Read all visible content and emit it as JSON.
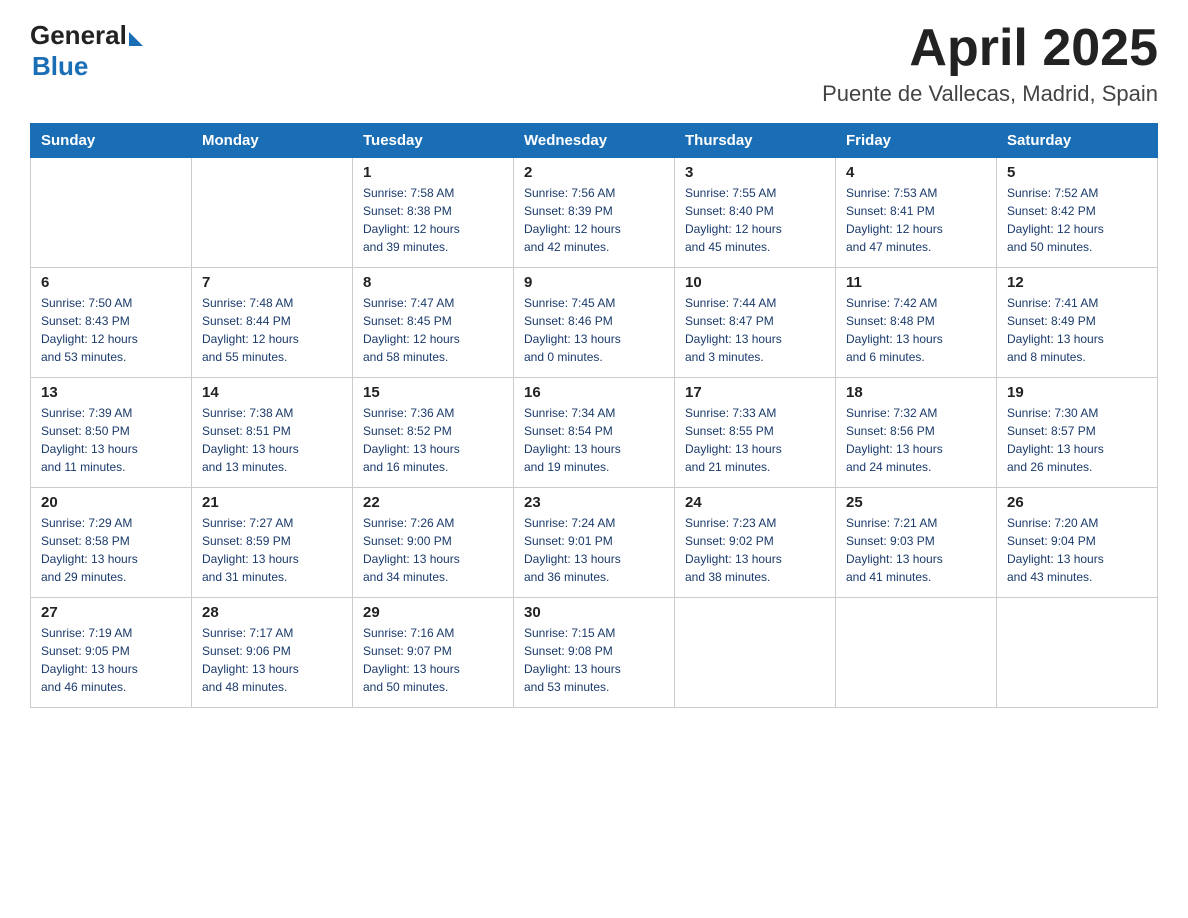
{
  "header": {
    "logo_general": "General",
    "logo_blue": "Blue",
    "month_title": "April 2025",
    "location": "Puente de Vallecas, Madrid, Spain"
  },
  "days_of_week": [
    "Sunday",
    "Monday",
    "Tuesday",
    "Wednesday",
    "Thursday",
    "Friday",
    "Saturday"
  ],
  "weeks": [
    [
      {
        "day": "",
        "detail": ""
      },
      {
        "day": "",
        "detail": ""
      },
      {
        "day": "1",
        "detail": "Sunrise: 7:58 AM\nSunset: 8:38 PM\nDaylight: 12 hours\nand 39 minutes."
      },
      {
        "day": "2",
        "detail": "Sunrise: 7:56 AM\nSunset: 8:39 PM\nDaylight: 12 hours\nand 42 minutes."
      },
      {
        "day": "3",
        "detail": "Sunrise: 7:55 AM\nSunset: 8:40 PM\nDaylight: 12 hours\nand 45 minutes."
      },
      {
        "day": "4",
        "detail": "Sunrise: 7:53 AM\nSunset: 8:41 PM\nDaylight: 12 hours\nand 47 minutes."
      },
      {
        "day": "5",
        "detail": "Sunrise: 7:52 AM\nSunset: 8:42 PM\nDaylight: 12 hours\nand 50 minutes."
      }
    ],
    [
      {
        "day": "6",
        "detail": "Sunrise: 7:50 AM\nSunset: 8:43 PM\nDaylight: 12 hours\nand 53 minutes."
      },
      {
        "day": "7",
        "detail": "Sunrise: 7:48 AM\nSunset: 8:44 PM\nDaylight: 12 hours\nand 55 minutes."
      },
      {
        "day": "8",
        "detail": "Sunrise: 7:47 AM\nSunset: 8:45 PM\nDaylight: 12 hours\nand 58 minutes."
      },
      {
        "day": "9",
        "detail": "Sunrise: 7:45 AM\nSunset: 8:46 PM\nDaylight: 13 hours\nand 0 minutes."
      },
      {
        "day": "10",
        "detail": "Sunrise: 7:44 AM\nSunset: 8:47 PM\nDaylight: 13 hours\nand 3 minutes."
      },
      {
        "day": "11",
        "detail": "Sunrise: 7:42 AM\nSunset: 8:48 PM\nDaylight: 13 hours\nand 6 minutes."
      },
      {
        "day": "12",
        "detail": "Sunrise: 7:41 AM\nSunset: 8:49 PM\nDaylight: 13 hours\nand 8 minutes."
      }
    ],
    [
      {
        "day": "13",
        "detail": "Sunrise: 7:39 AM\nSunset: 8:50 PM\nDaylight: 13 hours\nand 11 minutes."
      },
      {
        "day": "14",
        "detail": "Sunrise: 7:38 AM\nSunset: 8:51 PM\nDaylight: 13 hours\nand 13 minutes."
      },
      {
        "day": "15",
        "detail": "Sunrise: 7:36 AM\nSunset: 8:52 PM\nDaylight: 13 hours\nand 16 minutes."
      },
      {
        "day": "16",
        "detail": "Sunrise: 7:34 AM\nSunset: 8:54 PM\nDaylight: 13 hours\nand 19 minutes."
      },
      {
        "day": "17",
        "detail": "Sunrise: 7:33 AM\nSunset: 8:55 PM\nDaylight: 13 hours\nand 21 minutes."
      },
      {
        "day": "18",
        "detail": "Sunrise: 7:32 AM\nSunset: 8:56 PM\nDaylight: 13 hours\nand 24 minutes."
      },
      {
        "day": "19",
        "detail": "Sunrise: 7:30 AM\nSunset: 8:57 PM\nDaylight: 13 hours\nand 26 minutes."
      }
    ],
    [
      {
        "day": "20",
        "detail": "Sunrise: 7:29 AM\nSunset: 8:58 PM\nDaylight: 13 hours\nand 29 minutes."
      },
      {
        "day": "21",
        "detail": "Sunrise: 7:27 AM\nSunset: 8:59 PM\nDaylight: 13 hours\nand 31 minutes."
      },
      {
        "day": "22",
        "detail": "Sunrise: 7:26 AM\nSunset: 9:00 PM\nDaylight: 13 hours\nand 34 minutes."
      },
      {
        "day": "23",
        "detail": "Sunrise: 7:24 AM\nSunset: 9:01 PM\nDaylight: 13 hours\nand 36 minutes."
      },
      {
        "day": "24",
        "detail": "Sunrise: 7:23 AM\nSunset: 9:02 PM\nDaylight: 13 hours\nand 38 minutes."
      },
      {
        "day": "25",
        "detail": "Sunrise: 7:21 AM\nSunset: 9:03 PM\nDaylight: 13 hours\nand 41 minutes."
      },
      {
        "day": "26",
        "detail": "Sunrise: 7:20 AM\nSunset: 9:04 PM\nDaylight: 13 hours\nand 43 minutes."
      }
    ],
    [
      {
        "day": "27",
        "detail": "Sunrise: 7:19 AM\nSunset: 9:05 PM\nDaylight: 13 hours\nand 46 minutes."
      },
      {
        "day": "28",
        "detail": "Sunrise: 7:17 AM\nSunset: 9:06 PM\nDaylight: 13 hours\nand 48 minutes."
      },
      {
        "day": "29",
        "detail": "Sunrise: 7:16 AM\nSunset: 9:07 PM\nDaylight: 13 hours\nand 50 minutes."
      },
      {
        "day": "30",
        "detail": "Sunrise: 7:15 AM\nSunset: 9:08 PM\nDaylight: 13 hours\nand 53 minutes."
      },
      {
        "day": "",
        "detail": ""
      },
      {
        "day": "",
        "detail": ""
      },
      {
        "day": "",
        "detail": ""
      }
    ]
  ]
}
